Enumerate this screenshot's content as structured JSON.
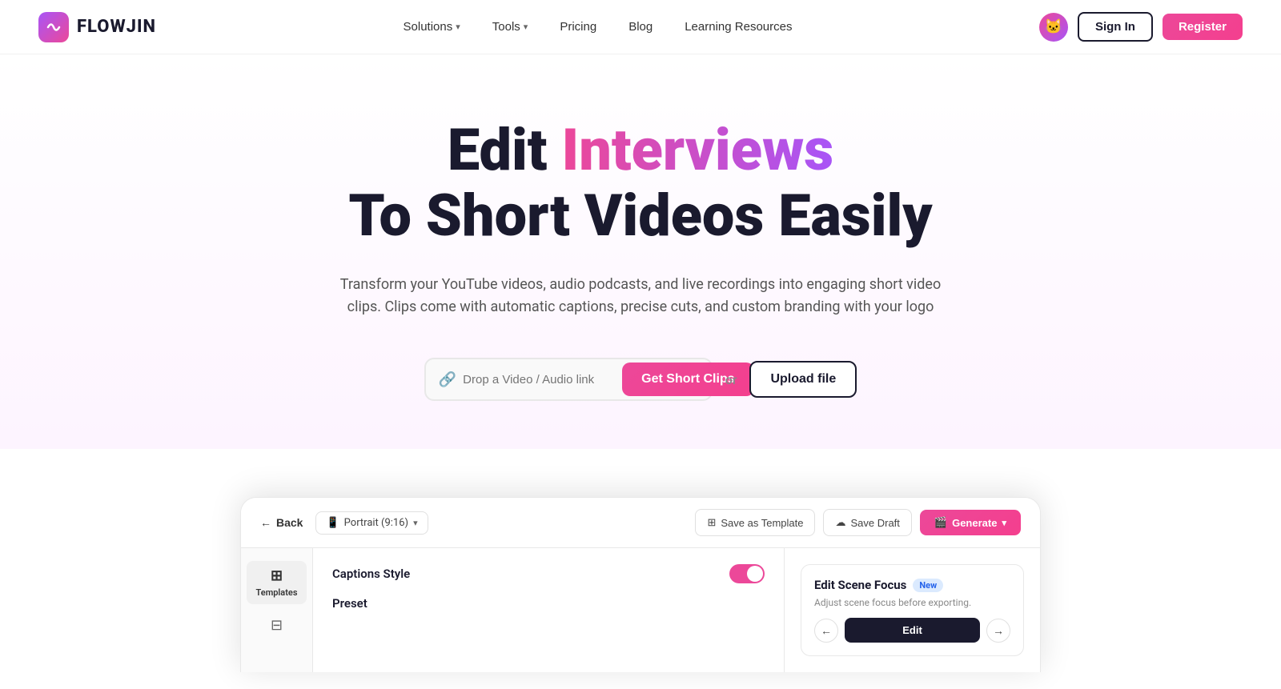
{
  "nav": {
    "logo_icon": "〜",
    "logo_text": "FLOWJIN",
    "links": [
      {
        "label": "Solutions",
        "has_dropdown": true
      },
      {
        "label": "Tools",
        "has_dropdown": true
      },
      {
        "label": "Pricing",
        "has_dropdown": false
      },
      {
        "label": "Blog",
        "has_dropdown": false
      },
      {
        "label": "Learning Resources",
        "has_dropdown": false
      }
    ],
    "signin_label": "Sign In",
    "register_label": "Register"
  },
  "hero": {
    "title_part1": "Edit ",
    "title_highlight": "Interviews",
    "title_line2": "To Short Videos Easily",
    "subtitle": "Transform your YouTube videos, audio podcasts, and live recordings into engaging short video clips. Clips come with automatic captions, precise cuts, and custom branding with your logo",
    "cta_placeholder": "Drop a Video / Audio link",
    "cta_button": "Get Short Clips",
    "cta_or": "or",
    "upload_button": "Upload file"
  },
  "preview": {
    "back_label": "Back",
    "portrait_label": "Portrait (9:16)",
    "save_template_label": "Save as Template",
    "save_draft_label": "Save Draft",
    "generate_label": "Generate",
    "sidebar_items": [
      {
        "icon": "⊞",
        "label": "Templates"
      },
      {
        "icon": "≡",
        "label": ""
      }
    ],
    "captions_label": "Captions Style",
    "preset_label": "Preset",
    "edit_scene": {
      "title": "Edit Scene Focus",
      "badge": "New",
      "description": "Adjust scene focus before exporting.",
      "edit_button": "Edit"
    }
  }
}
